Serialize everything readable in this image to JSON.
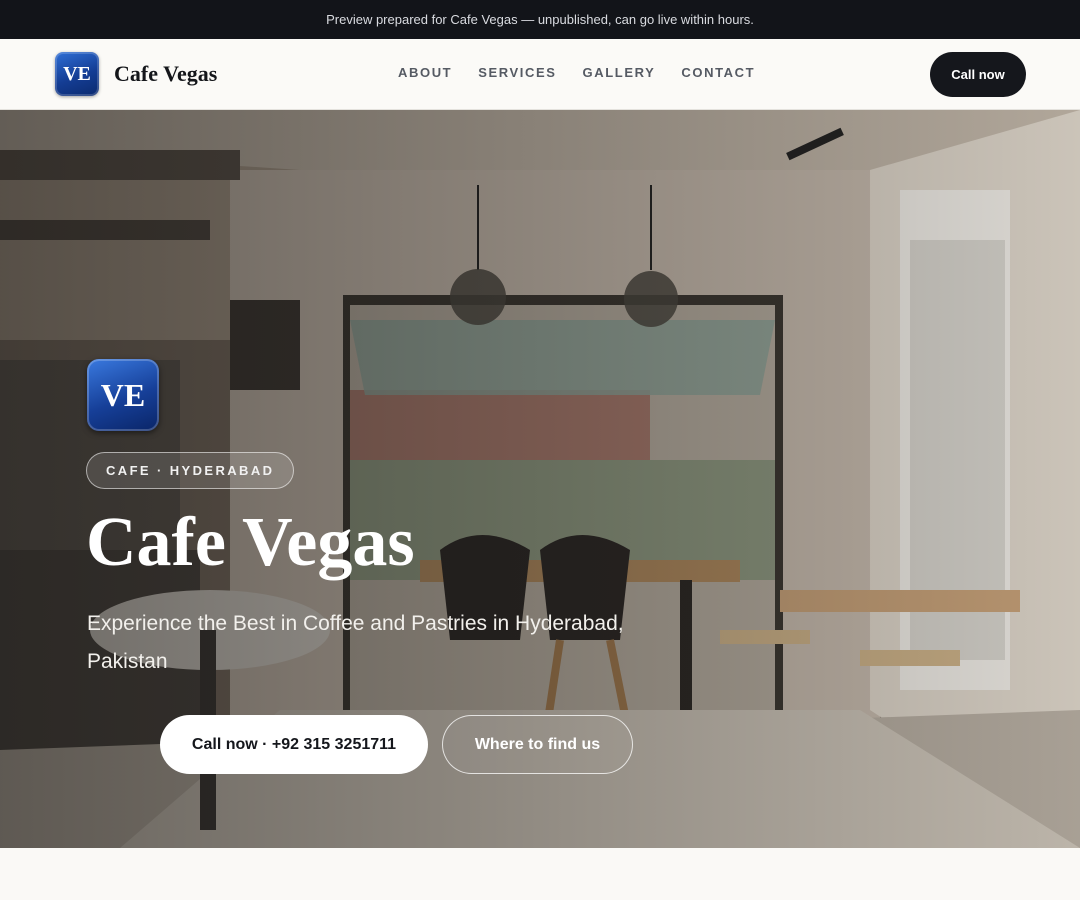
{
  "banner": {
    "text": "Preview prepared for Cafe Vegas — unpublished, can go live within hours."
  },
  "header": {
    "logo_initials": "VE",
    "brand_name": "Cafe Vegas",
    "nav": [
      "ABOUT",
      "SERVICES",
      "GALLERY",
      "CONTACT"
    ],
    "call_label": "Call now"
  },
  "hero": {
    "logo_initials": "VE",
    "tag": "CAFE · HYDERABAD",
    "title": "Cafe Vegas",
    "subtitle": "Experience the Best in Coffee and Pastries in Hyderabad, Pakistan",
    "primary_button": "Call now · +92 315 3251711",
    "secondary_button": "Where to find us"
  },
  "colors": {
    "dark": "#15171c",
    "brand_blue": "#143d94",
    "background": "#faf9f6"
  }
}
